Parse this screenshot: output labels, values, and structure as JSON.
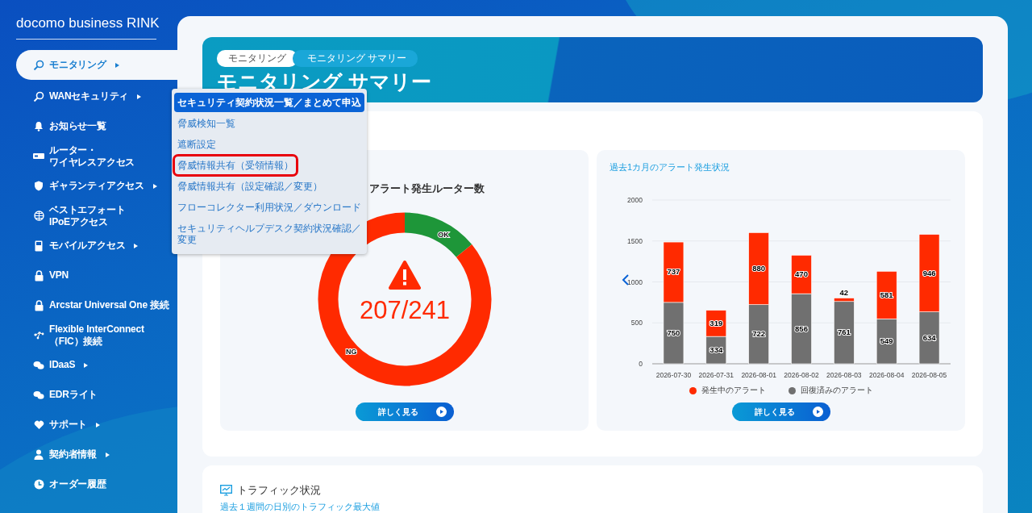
{
  "brand": "docomo business RINK",
  "sidebar": {
    "items": [
      {
        "label": "モニタリング",
        "selected": true,
        "has_submenu": true
      },
      {
        "label": "WANセキュリティ",
        "selected": false,
        "has_submenu": true
      },
      {
        "label": "お知らせ一覧",
        "selected": false,
        "has_submenu": false
      },
      {
        "label_lines": [
          "ルーター・",
          "ワイヤレスアクセス"
        ],
        "selected": false,
        "has_submenu": false
      },
      {
        "label": "ギャランティアクセス",
        "selected": false,
        "has_submenu": true
      },
      {
        "label_lines": [
          "ベストエフォート",
          "IPoEアクセス"
        ],
        "selected": false,
        "has_submenu": false
      },
      {
        "label": "モバイルアクセス",
        "selected": false,
        "has_submenu": true
      },
      {
        "label": "VPN",
        "selected": false,
        "has_submenu": false
      },
      {
        "label": "Arcstar Universal One 接続",
        "selected": false,
        "has_submenu": false
      },
      {
        "label_lines": [
          "Flexible InterConnect",
          "（FIC）接続"
        ],
        "selected": false,
        "has_submenu": false
      },
      {
        "label": "IDaaS",
        "selected": false,
        "has_submenu": true
      },
      {
        "label": "EDRライト",
        "selected": false,
        "has_submenu": false
      },
      {
        "label": "サポート",
        "selected": false,
        "has_submenu": true
      },
      {
        "label": "契約者情報",
        "selected": false,
        "has_submenu": true
      },
      {
        "label": "オーダー履歴",
        "selected": false,
        "has_submenu": false
      }
    ]
  },
  "flyout_menu": {
    "items": [
      {
        "label": "セキュリティ契約状況一覧／まとめて申込",
        "selected": true,
        "marked": false
      },
      {
        "label": "脅威検知一覧",
        "selected": false,
        "marked": false
      },
      {
        "label": "遮断設定",
        "selected": false,
        "marked": false
      },
      {
        "label": "脅威情報共有（受領情報）",
        "selected": false,
        "marked": true
      },
      {
        "label": "脅威情報共有（設定確認／変更）",
        "selected": false,
        "marked": false
      },
      {
        "label": "フローコレクター利用状況／ダウンロード",
        "selected": false,
        "marked": false
      },
      {
        "label_lines": [
          "セキュリティヘルプデスク契約状況確認／",
          "変更"
        ],
        "selected": false,
        "marked": false
      }
    ]
  },
  "header": {
    "breadcrumb": [
      "モニタリング",
      "モニタリング サマリー"
    ],
    "title": "モニタリング サマリー"
  },
  "router_panel": {
    "title": "アラート発生ルーター数",
    "reading": "207/241",
    "segments": [
      {
        "label": "OK",
        "color": "#1e9639"
      },
      {
        "label": "NG",
        "color": "#ff2a00"
      }
    ],
    "button": "詳しく見る"
  },
  "alert_panel": {
    "title": "過去1カ月のアラート発生状況",
    "button": "詳しく見る",
    "chart_data": {
      "type": "bar",
      "stacked": true,
      "data_labels": true,
      "grid": true,
      "categories": [
        "2026-07-30",
        "2026-07-31",
        "2026-08-01",
        "2026-08-02",
        "2026-08-03",
        "2026-08-04",
        "2026-08-05"
      ],
      "series": [
        {
          "name": "回復済みのアラート",
          "color": "#707070",
          "values": [
            750,
            334,
            722,
            856,
            761,
            549,
            634
          ]
        },
        {
          "name": "発生中のアラート",
          "color": "#ff2a00",
          "values": [
            737,
            319,
            880,
            470,
            42,
            581,
            946
          ]
        }
      ],
      "ylim": [
        0,
        2000
      ],
      "yticks": [
        0,
        500,
        1000,
        1500,
        2000
      ]
    }
  },
  "traffic": {
    "title": "トラフィック状況",
    "link": "過去１週間の日別のトラフィック最大値"
  }
}
